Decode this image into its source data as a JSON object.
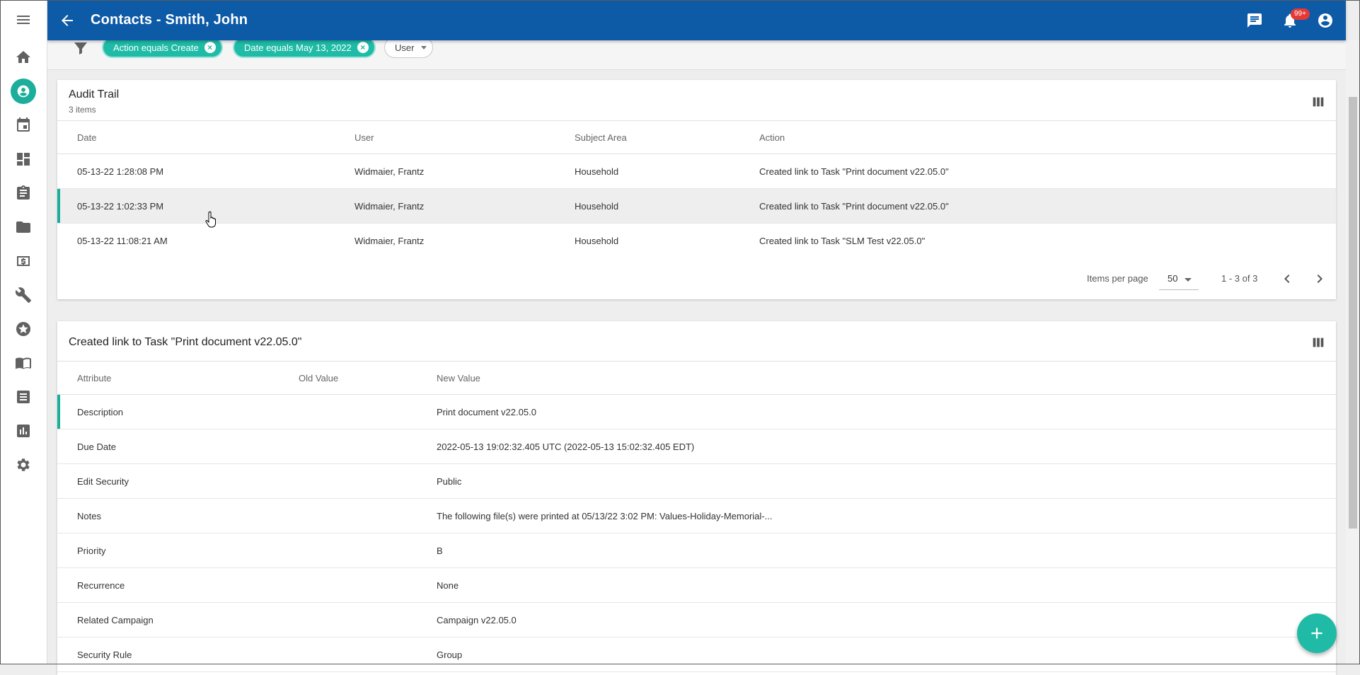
{
  "appbar": {
    "title": "Contacts - Smith, John",
    "badge": "99+"
  },
  "colors": {
    "primary": "#0d5aa7",
    "accent": "#1fbba6"
  },
  "rail": {
    "items": [
      "menu-icon",
      "home-icon",
      "contact-icon",
      "calendar-icon",
      "dashboard-icon",
      "clipboard-icon",
      "folder-icon",
      "money-icon",
      "wrench-icon",
      "star-icon",
      "book-icon",
      "list-icon",
      "report-icon",
      "settings-icon"
    ],
    "active": "contact-icon"
  },
  "filters": {
    "chips": [
      {
        "label": "Action equals Create"
      },
      {
        "label": "Date equals May 13, 2022"
      }
    ],
    "user_dropdown": "User"
  },
  "audit": {
    "title": "Audit Trail",
    "subtitle": "3 items",
    "columns": [
      "Date",
      "User",
      "Subject Area",
      "Action"
    ],
    "rows": [
      {
        "date": "05-13-22 1:28:08 PM",
        "user": "Widmaier, Frantz",
        "subject": "Household",
        "action": "Created link to Task \"Print document v22.05.0\""
      },
      {
        "date": "05-13-22 1:02:33 PM",
        "user": "Widmaier, Frantz",
        "subject": "Household",
        "action": "Created link to Task \"Print document v22.05.0\""
      },
      {
        "date": "05-13-22 11:08:21 AM",
        "user": "Widmaier, Frantz",
        "subject": "Household",
        "action": "Created link to Task \"SLM Test v22.05.0\""
      }
    ],
    "pager": {
      "items_per_page_label": "Items per page",
      "per_page": "50",
      "range": "1 - 3 of 3"
    }
  },
  "detail": {
    "title": "Created link to Task \"Print document v22.05.0\"",
    "columns": [
      "Attribute",
      "Old Value",
      "New Value"
    ],
    "rows": [
      {
        "attr": "Description",
        "old": "",
        "new": "Print document v22.05.0"
      },
      {
        "attr": "Due Date",
        "old": "",
        "new": "2022-05-13 19:02:32.405 UTC (2022-05-13 15:02:32.405 EDT)"
      },
      {
        "attr": "Edit Security",
        "old": "",
        "new": "Public"
      },
      {
        "attr": "Notes",
        "old": "",
        "new": "The following file(s) were printed at 05/13/22 3:02 PM: Values-Holiday-Memorial-..."
      },
      {
        "attr": "Priority",
        "old": "",
        "new": "B"
      },
      {
        "attr": "Recurrence",
        "old": "",
        "new": "None"
      },
      {
        "attr": "Related Campaign",
        "old": "",
        "new": "Campaign v22.05.0"
      },
      {
        "attr": "Security Rule",
        "old": "",
        "new": "Group"
      }
    ]
  }
}
